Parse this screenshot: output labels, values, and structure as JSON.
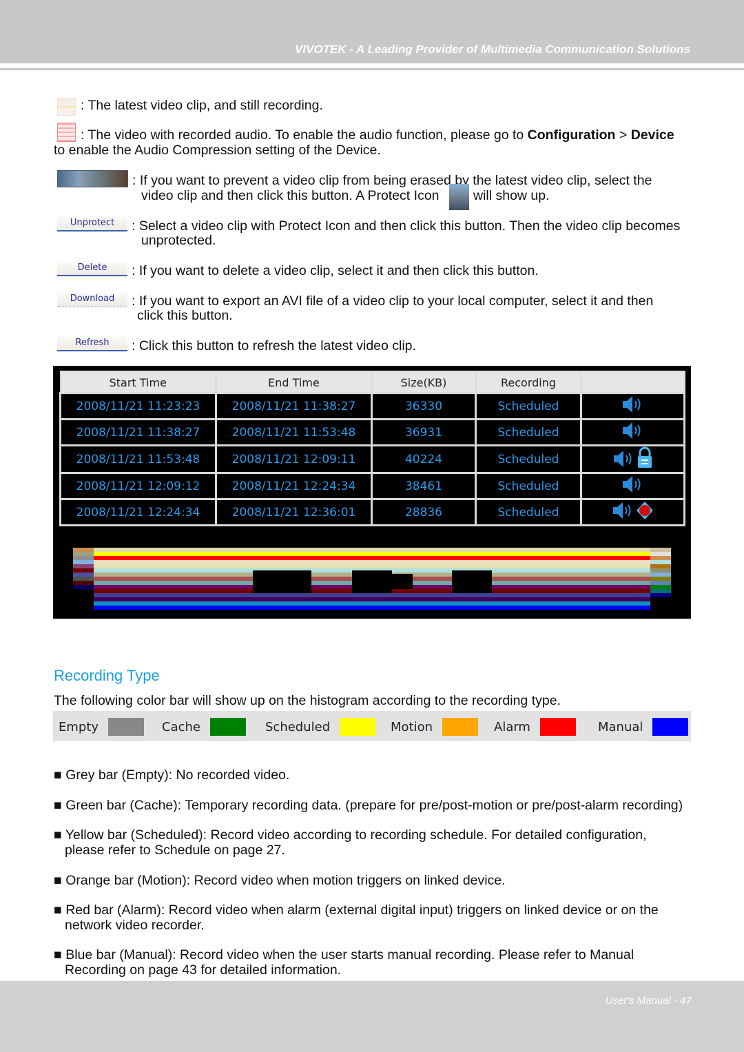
{
  "header": {
    "tagline": "VIVOTEK - A Leading Provider of Multimedia Communication Solutions"
  },
  "icons_desc": [
    {
      "icon": "latest-clip-recording-icon",
      "text": ": The latest video clip, and still recording."
    },
    {
      "icon": "recorded-audio-icon",
      "text_pre": ": The video with recorded audio. To enable the audio function, please go to ",
      "bold1": "Configuration",
      "sep": " > ",
      "bold2": "Device",
      "line2": "to enable the Audio Compression setting of the Device."
    },
    {
      "icon": "protect-button-icon",
      "line1": ":  If you want to prevent a video clip from being erased by the latest video clip, select the",
      "line2a": "video clip and then click this button. A Protect Icon",
      "line2b": "will show up."
    }
  ],
  "buttons": [
    {
      "label": "Unprotect",
      "line1": ": Select a video clip with Protect Icon and then click this button. Then the video clip becomes",
      "line2": "unprotected."
    },
    {
      "label": "Delete",
      "line1": ": If you want to delete a video clip, select it and then click this button."
    },
    {
      "label": "Download",
      "line1": ": If you want to export an AVI file of a video clip to your local computer, select it and then",
      "line2": "click this button."
    },
    {
      "label": "Refresh",
      "line1": ": Click this button to refresh the latest video clip."
    }
  ],
  "table": {
    "headers": [
      "Start Time",
      "End Time",
      "Size(KB)",
      "Recording",
      ""
    ],
    "rows": [
      {
        "start": "2008/11/21 11:23:23",
        "end": "2008/11/21 11:38:27",
        "size": "36330",
        "rec": "Scheduled",
        "icons": [
          "speaker"
        ]
      },
      {
        "start": "2008/11/21 11:38:27",
        "end": "2008/11/21 11:53:48",
        "size": "36931",
        "rec": "Scheduled",
        "icons": [
          "speaker"
        ]
      },
      {
        "start": "2008/11/21 11:53:48",
        "end": "2008/11/21 12:09:11",
        "size": "40224",
        "rec": "Scheduled",
        "icons": [
          "speaker",
          "lock"
        ]
      },
      {
        "start": "2008/11/21 12:09:12",
        "end": "2008/11/21 12:24:34",
        "size": "38461",
        "rec": "Scheduled",
        "icons": [
          "speaker"
        ]
      },
      {
        "start": "2008/11/21 12:24:34",
        "end": "2008/11/21 12:36:01",
        "size": "28836",
        "rec": "Scheduled",
        "icons": [
          "speaker",
          "recording"
        ]
      }
    ]
  },
  "section": {
    "title": "Recording Type",
    "intro": "The following color bar will show up on the histogram according to the recording type."
  },
  "legend": [
    {
      "label": "Empty",
      "color": "#888888"
    },
    {
      "label": "Cache",
      "color": "#008000"
    },
    {
      "label": "Scheduled",
      "color": "#ffff00"
    },
    {
      "label": "Motion",
      "color": "#ffa500"
    },
    {
      "label": "Alarm",
      "color": "#ff0000"
    },
    {
      "label": "Manual",
      "color": "#0000ff"
    }
  ],
  "bullets": [
    {
      "line1": "■ Grey bar (Empty): No recorded video."
    },
    {
      "line1": "■ Green bar (Cache): Temporary recording data. (prepare for pre/post-motion or pre/post-alarm recording)"
    },
    {
      "line1": "■ Yellow bar (Scheduled): Record video according to recording schedule. For detailed configuration,",
      "line2": "please refer to Schedule on page 27."
    },
    {
      "line1": "■ Orange bar (Motion): Record video when motion triggers on linked device."
    },
    {
      "line1": "■ Red bar (Alarm): Record video when alarm (external digital input) triggers on linked device or on the",
      "line2": "network video recorder."
    },
    {
      "line1": "■ Blue bar (Manual): Record video when the user starts manual recording. Please refer to Manual",
      "line2": "Recording on page 43 for detailed information."
    }
  ],
  "footer": {
    "page": "User's Manual - 47"
  }
}
